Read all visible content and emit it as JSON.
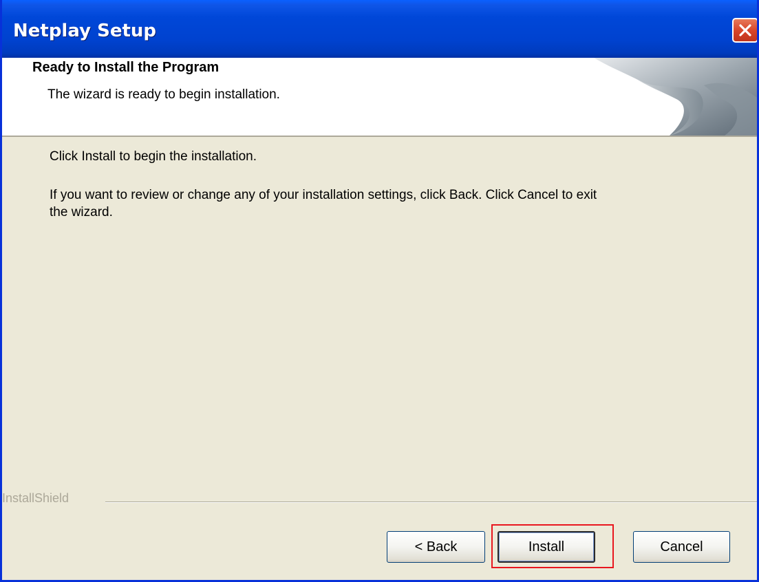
{
  "window": {
    "title": "Netplay Setup"
  },
  "header": {
    "title": "Ready to Install the Program",
    "subtitle": "The wizard is ready to begin installation."
  },
  "body": {
    "line1": "Click Install to begin the installation.",
    "line2": "If you want to review or change any of your installation settings, click Back. Click Cancel to exit",
    "line3": "the wizard."
  },
  "footer": {
    "brand": "InstallShield"
  },
  "buttons": {
    "back": "< Back",
    "install": "Install",
    "cancel": "Cancel"
  },
  "colors": {
    "titlebar": "#0047d8",
    "dialog_bg": "#ece9d8",
    "highlight": "#e8161e"
  }
}
